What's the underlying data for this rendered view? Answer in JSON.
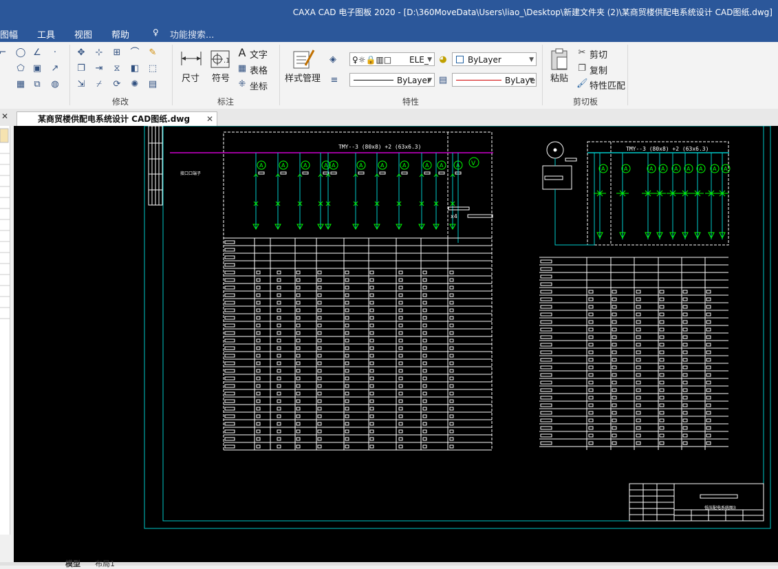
{
  "window": {
    "title": "CAXA CAD 电子图板 2020 - [D:\\360MoveData\\Users\\liao_\\Desktop\\新建文件夹 (2)\\某商贸楼供配电系统设计 CAD图纸.dwg]"
  },
  "menu": {
    "items": [
      "图幅",
      "工具",
      "视图",
      "帮助"
    ],
    "search_placeholder": "功能搜索..."
  },
  "ribbon": {
    "groups": {
      "modify": "修改",
      "annotate": "标注",
      "properties": "特性",
      "clipboard": "剪切板"
    },
    "annotate": {
      "dimension": "尺寸",
      "symbol": "符号",
      "text": "文字",
      "table": "表格",
      "coordinate": "坐标"
    },
    "style_manager": "样式管理",
    "layer_value": "ELE_",
    "color_value": "ByLayer",
    "linetype_value": "ByLayer",
    "lineweight_value": "ByLayer",
    "clipboard": {
      "paste": "粘贴",
      "cut": "剪切",
      "copy": "复制",
      "match": "特性匹配"
    }
  },
  "document": {
    "tab_label": "某商贸楼供配电系统设计 CAD图纸.dwg"
  },
  "drawing": {
    "left_busbar_label": "TMY--3 (80x8) +2 (63x6.3)",
    "right_busbar_label": "TMY--3 (80x8) +2 (63x6.3)",
    "ammeter_symbol": "A",
    "voltmeter_symbol": "V",
    "x4_label": "x4",
    "title_block_label": "低压配电系统图3"
  },
  "bottom_tabs": [
    "模型",
    "布局1"
  ],
  "colors": {
    "titlebar": "#2b579a",
    "canvas": "#000000",
    "frame": "#00c8c8",
    "busbar": "#d000d0",
    "wire": "#00cccc",
    "component": "#00ff00",
    "lines": "#ffffff"
  }
}
